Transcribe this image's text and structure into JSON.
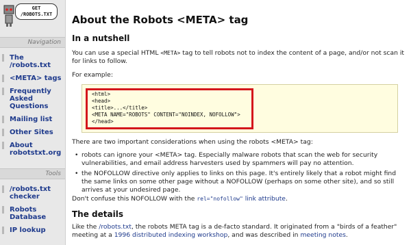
{
  "logo": {
    "bubble_line1": "GET",
    "bubble_line2": "/ROBOTS.TXT"
  },
  "sidebar": {
    "navigation_heading": "Navigation",
    "nav_items": [
      {
        "label": "The /robots.txt"
      },
      {
        "label": "<META> tags"
      },
      {
        "label": "Frequently Asked Questions"
      },
      {
        "label": "Mailing list"
      },
      {
        "label": "Other Sites"
      },
      {
        "label": "About robotstxt.org"
      }
    ],
    "tools_heading": "Tools",
    "tool_items": [
      {
        "label": "/robots.txt checker"
      },
      {
        "label": "Robots Database"
      },
      {
        "label": "IP lookup"
      }
    ]
  },
  "main": {
    "title": "About the Robots <META> tag",
    "nutshell_heading": "In a nutshell",
    "intro_pre": "You can use a special HTML ",
    "intro_code": "<META>",
    "intro_post": " tag to tell robots not to index the content of a page, and/or not scan it for links to follow.",
    "example_label": "For example:",
    "code_lines": [
      "<html>",
      "<head>",
      "<title>...</title>",
      "<META NAME=\"ROBOTS\" CONTENT=\"NOINDEX, NOFOLLOW\">",
      "</head>"
    ],
    "considerations": "There are two important considerations when using the robots <META> tag:",
    "bullets": [
      "robots can ignore your <META> tag. Especially malware robots that scan the web for security vulnerabilities, and email address harvesters used by spammers will pay no attention.",
      "the NOFOLLOW directive only applies to links on this page. It's entirely likely that a robot might find the same links on some other page without a NOFOLLOW (perhaps on some other site), and so still arrives at your undesired page."
    ],
    "confuse_pre": "Don't confuse this NOFOLLOW with the ",
    "confuse_code": "rel=\"nofollow\"",
    "confuse_link": " link attribute",
    "confuse_post": ".",
    "details_heading": "The details",
    "details_p1": "Like the ",
    "details_link1": "/robots.txt",
    "details_p2": ", the robots META tag is a de-facto standard. It originated from a \"birds of a feather\" meeting at a ",
    "details_link2": "1996 distributed indexing workshop",
    "details_p3": ", and was described in ",
    "details_link3": "meeting notes",
    "details_p4": "."
  }
}
